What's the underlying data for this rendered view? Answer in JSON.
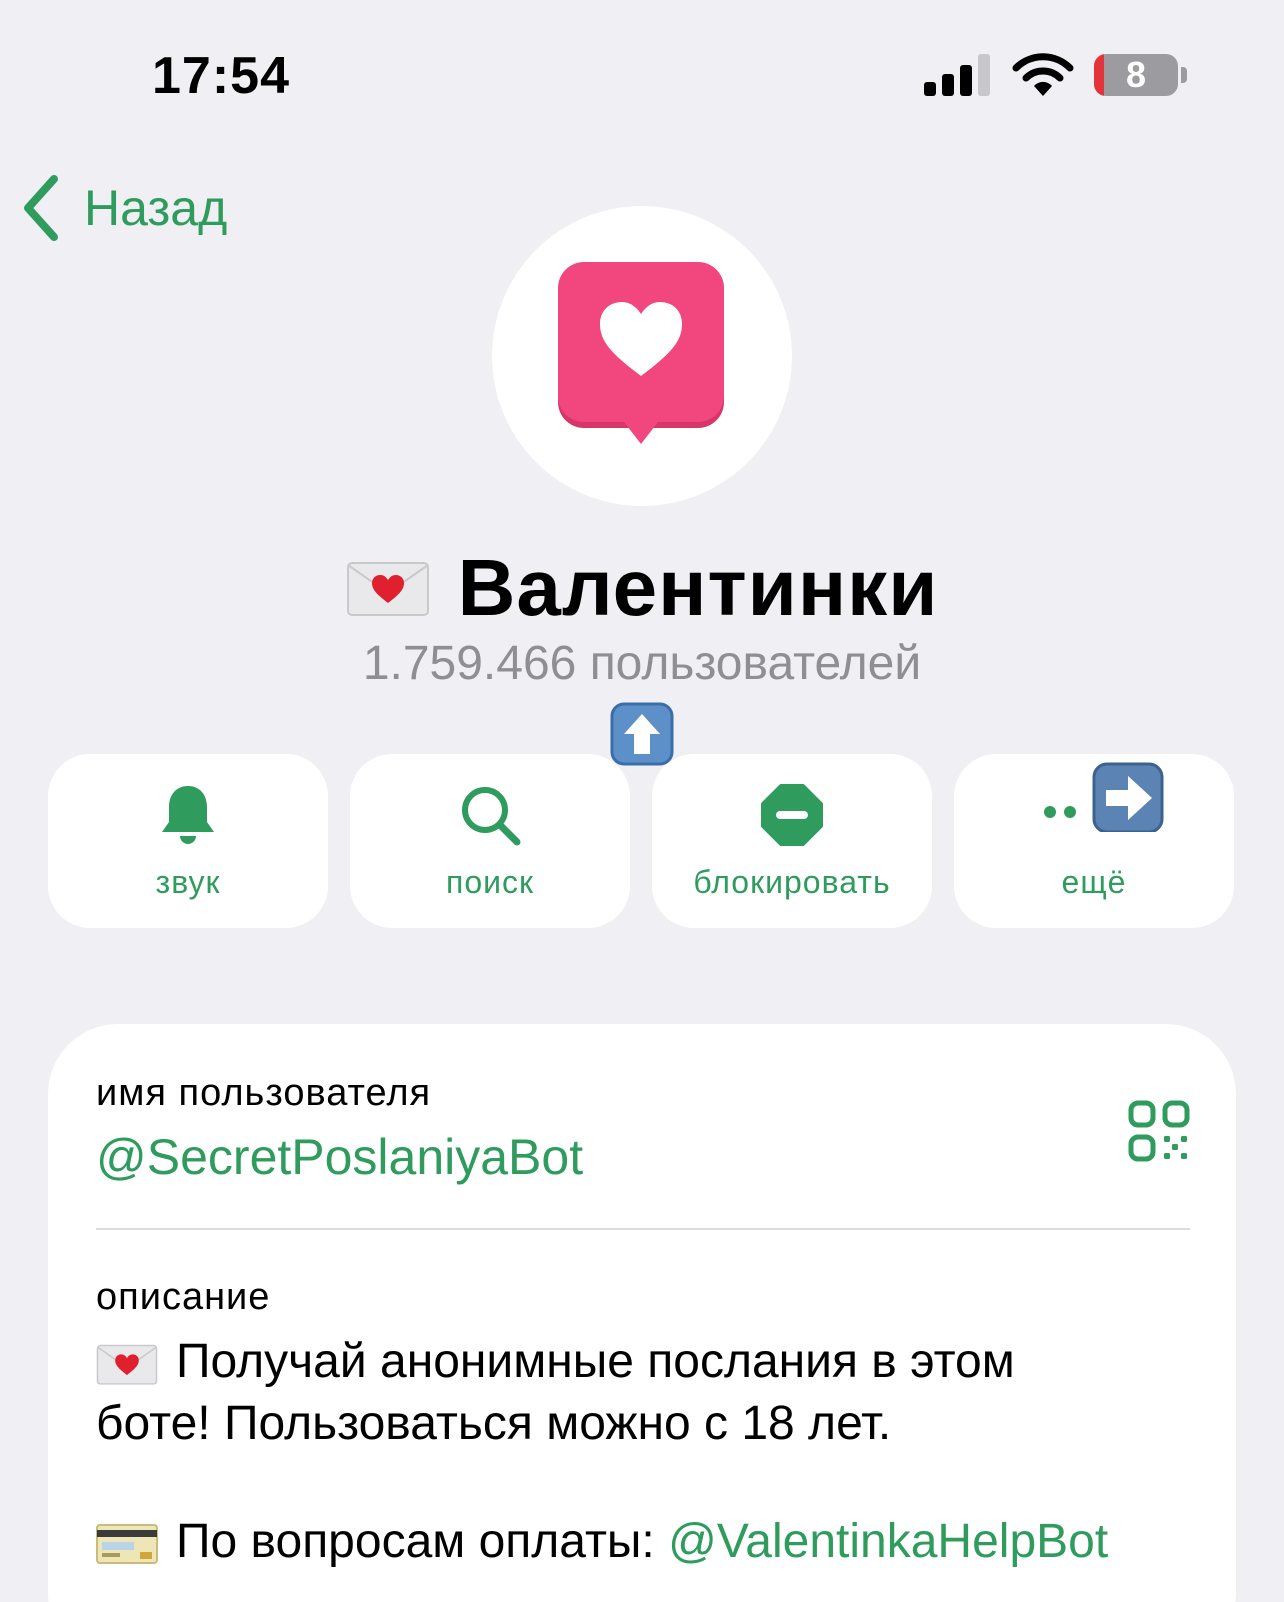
{
  "status_bar": {
    "time": "17:54",
    "battery_level": "8",
    "icons": [
      "cellular-signal-icon",
      "wifi-icon",
      "battery-icon"
    ]
  },
  "nav": {
    "back_label": "Назад"
  },
  "profile": {
    "title_emoji": "love-letter-emoji",
    "title": "Валентинки",
    "subtitle": "1.759.466 пользователей",
    "badge_emoji": "up-arrow-emoji"
  },
  "actions": [
    {
      "label": "звук",
      "icon": "bell-icon"
    },
    {
      "label": "поиск",
      "icon": "search-icon"
    },
    {
      "label": "блокировать",
      "icon": "block-icon"
    },
    {
      "label": "ещё",
      "icon": "more-icon"
    }
  ],
  "info": {
    "username_label": "имя пользователя",
    "username": "@SecretPoslaniyaBot",
    "description_label": "описание",
    "description_line1": "Получай анонимные послания в этом",
    "description_line2": "боте! Пользоваться можно с 18 лет.",
    "payment_text": "По вопросам оплаты: ",
    "payment_link": "@ValentinkaHelpBot"
  },
  "colors": {
    "accent": "#2f9c5e",
    "background": "#efeff4",
    "avatar_pink": "#f2467e",
    "subtitle_gray": "#8e8e93"
  }
}
